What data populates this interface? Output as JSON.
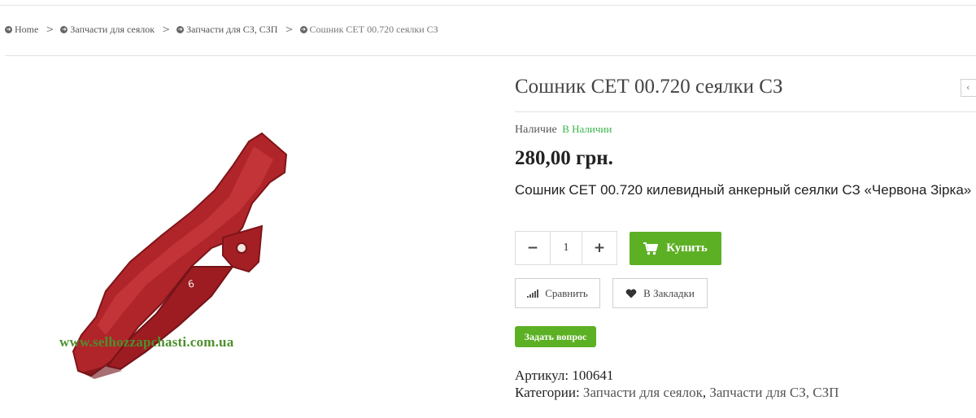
{
  "breadcrumb": {
    "items": [
      {
        "label": "Home"
      },
      {
        "label": "Запчасти для сеялок"
      },
      {
        "label": "Запчасти для СЗ, СЗП"
      },
      {
        "label": "Сошник СЕТ 00.720 сеялки СЗ"
      }
    ],
    "separator": ">"
  },
  "product": {
    "title": "Сошник СЕТ 00.720 сеялки СЗ",
    "availability_label": "Наличие",
    "availability_status": "В Наличии",
    "price": "280,00 грн.",
    "description": "Сошник СЕТ 00.720 килевидный анкерный сеялки СЗ «Червона Зірка»",
    "image_watermark": "www.selhozzapchasti.com.ua",
    "sku_label": "Артикул:",
    "sku": "100641",
    "categories_label": "Категории:",
    "categories": [
      "Запчасти для сеялок",
      "Запчасти для СЗ, СЗП"
    ]
  },
  "cart": {
    "quantity": "1",
    "minus": "−",
    "plus": "+",
    "buy_label": "Купить"
  },
  "actions": {
    "compare_label": "Сравнить",
    "wishlist_label": "В Закладки",
    "ask_label": "Задать вопрос"
  },
  "nav": {
    "prev_icon": "‹"
  },
  "colors": {
    "accent_green": "#5cb024",
    "status_green": "#39b54a",
    "product_red": "#b0252a"
  }
}
